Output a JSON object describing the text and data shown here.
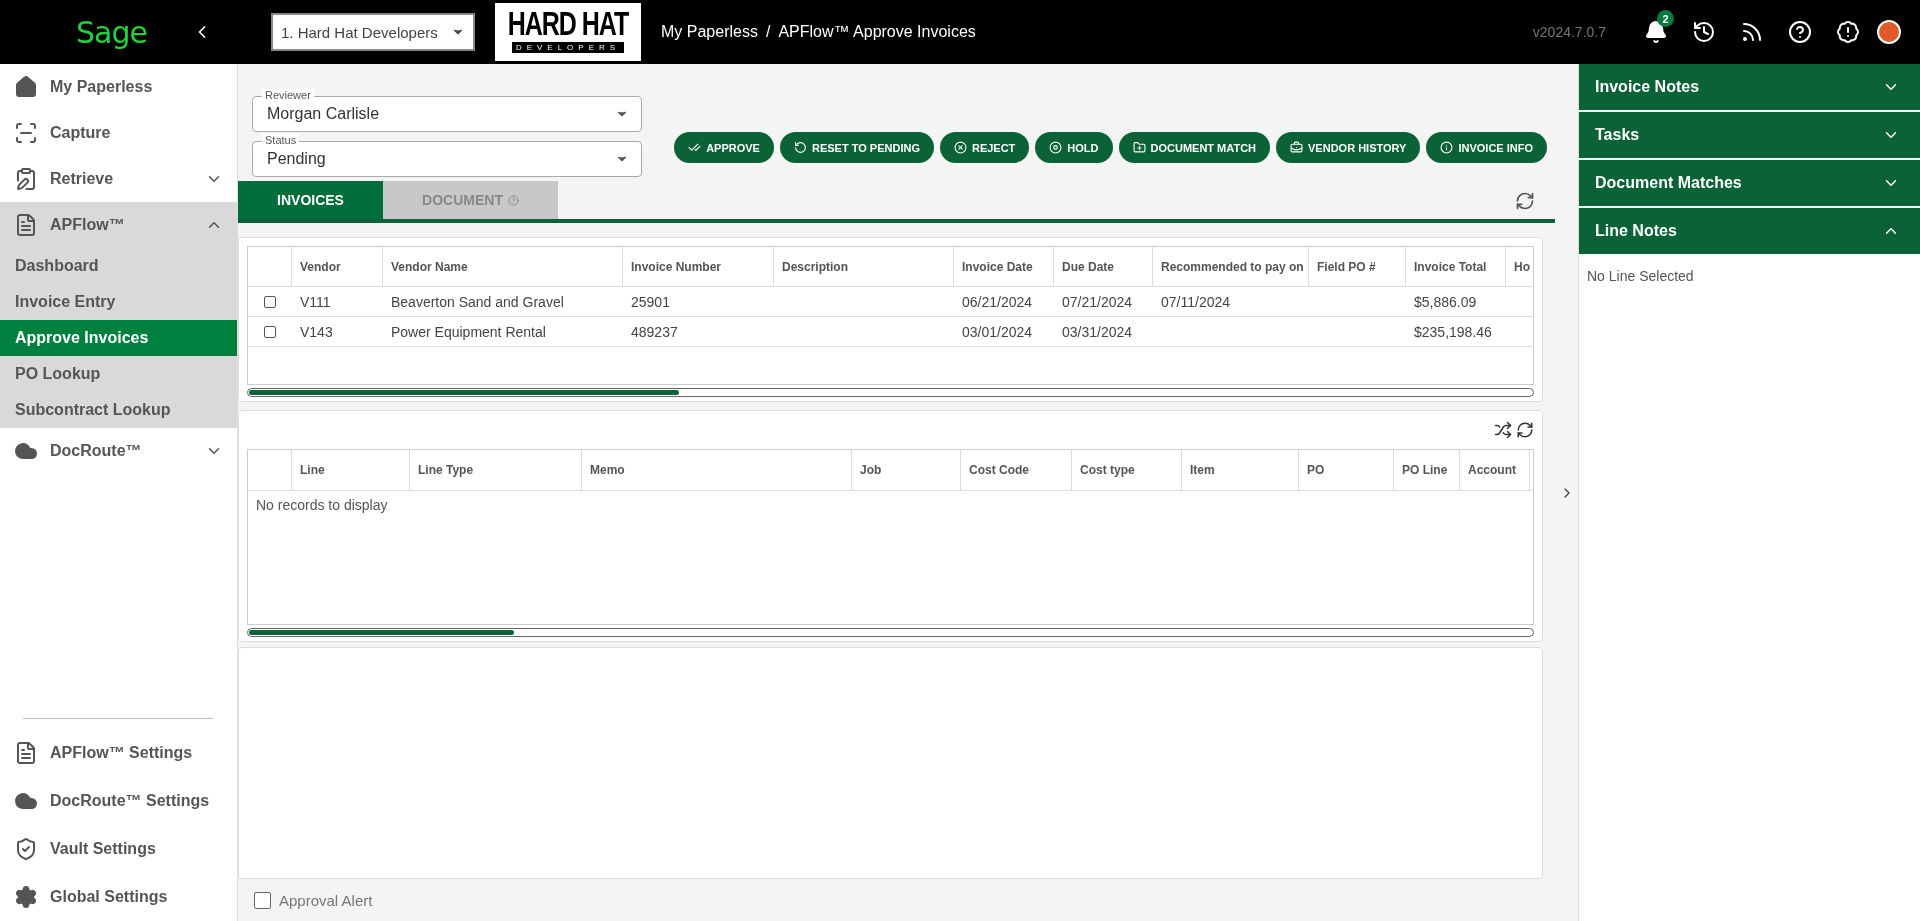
{
  "topbar": {
    "logo": "Sage",
    "company": "1. Hard Hat Developers",
    "brand": {
      "line1": "HARD HAT",
      "line2": "DEVELOPERS"
    },
    "breadcrumb": [
      "My Paperless",
      "/",
      "APFlow™ Approve Invoices"
    ],
    "version": "v2024.7.0.7",
    "notifications": "2"
  },
  "sidebar": {
    "items": [
      {
        "kind": "link",
        "label": "My Paperless",
        "selected": false
      },
      {
        "kind": "link",
        "label": "Capture",
        "selected": false
      },
      {
        "kind": "group",
        "label": "Retrieve",
        "selected": false,
        "expanded": false
      },
      {
        "kind": "group",
        "label": "APFlow™",
        "selected": false,
        "expanded": true,
        "children": [
          {
            "label": "Dashboard",
            "selected": false
          },
          {
            "label": "Invoice Entry",
            "selected": false
          },
          {
            "label": "Approve Invoices",
            "selected": true
          },
          {
            "label": "PO Lookup",
            "selected": false
          },
          {
            "label": "Subcontract Lookup",
            "selected": false
          }
        ]
      },
      {
        "kind": "group",
        "label": "DocRoute™",
        "selected": false,
        "expanded": false
      }
    ],
    "settings": [
      {
        "label": "APFlow™ Settings"
      },
      {
        "label": "DocRoute™ Settings"
      },
      {
        "label": "Vault Settings"
      },
      {
        "label": "Global Settings"
      }
    ]
  },
  "filters": [
    {
      "label": "Reviewer",
      "value": "Morgan Carlisle"
    },
    {
      "label": "Status",
      "value": "Pending"
    }
  ],
  "actions": [
    "APPROVE",
    "RESET TO PENDING",
    "REJECT",
    "HOLD",
    "DOCUMENT MATCH",
    "VENDOR HISTORY",
    "INVOICE INFO"
  ],
  "tabs": [
    {
      "label": "INVOICES",
      "selected": true
    },
    {
      "label": "DOCUMENT",
      "selected": false
    }
  ],
  "invoices": {
    "columns": [
      "Vendor",
      "Vendor Name",
      "Invoice Number",
      "Description",
      "Invoice Date",
      "Due Date",
      "Recommended to pay on",
      "Field PO #",
      "Invoice Total",
      "Ho"
    ],
    "rows": [
      {
        "checked": false,
        "cells": [
          "V111",
          "Beaverton Sand and Gravel",
          "25901",
          "",
          "06/21/2024",
          "07/21/2024",
          "07/11/2024",
          "",
          "$5,886.09",
          ""
        ]
      },
      {
        "checked": false,
        "cells": [
          "V143",
          "Power Equipment Rental",
          "489237",
          "",
          "03/01/2024",
          "03/31/2024",
          "",
          "",
          "$235,198.46",
          ""
        ]
      }
    ]
  },
  "lines": {
    "columns": [
      "Line",
      "Line Type",
      "Memo",
      "Job",
      "Cost Code",
      "Cost type",
      "Item",
      "PO",
      "PO Line",
      "Account"
    ],
    "empty": "No records to display"
  },
  "approval_alert": {
    "label": "Approval Alert",
    "checked": false
  },
  "right_panel": [
    {
      "title": "Invoice Notes",
      "expanded": false
    },
    {
      "title": "Tasks",
      "expanded": false
    },
    {
      "title": "Document Matches",
      "expanded": false
    },
    {
      "title": "Line Notes",
      "expanded": true,
      "content": "No Line Selected"
    }
  ]
}
